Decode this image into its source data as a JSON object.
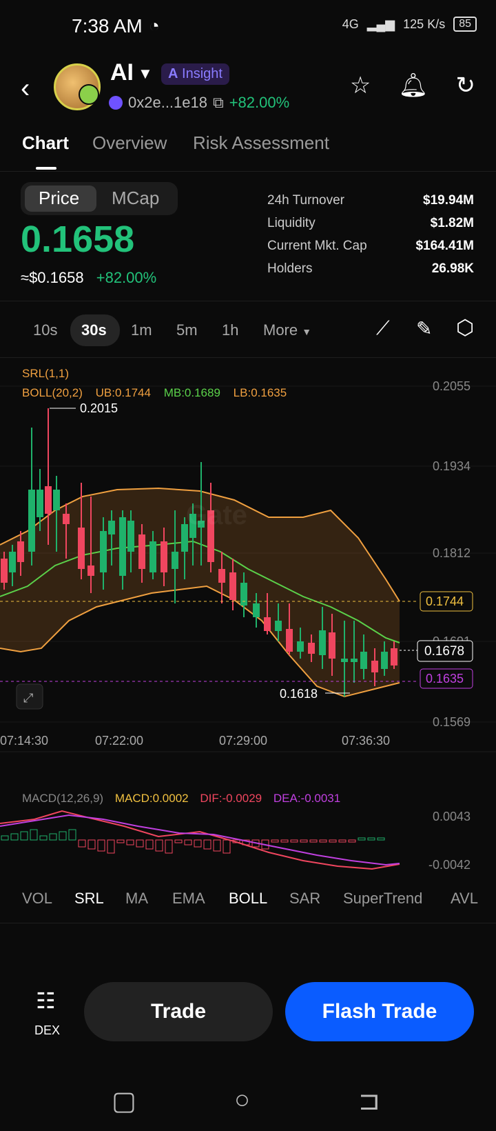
{
  "status": {
    "time": "7:38 AM",
    "net": "4G",
    "speed": "125 K/s",
    "battery": "85"
  },
  "header": {
    "token": "AI",
    "insight": "Insight",
    "address": "0x2e...1e18",
    "change": "+82.00%"
  },
  "tabs": [
    "Chart",
    "Overview",
    "Risk Assessment"
  ],
  "price": {
    "toggle": [
      "Price",
      "MCap"
    ],
    "current": "0.1658",
    "usd": "≈$0.1658",
    "change": "+82.00%"
  },
  "stats": [
    {
      "label": "24h   Turnover",
      "value": "$19.94M"
    },
    {
      "label": "Liquidity",
      "value": "$1.82M"
    },
    {
      "label": "Current Mkt. Cap",
      "value": "$164.41M"
    },
    {
      "label": "Holders",
      "value": "26.98K"
    }
  ],
  "intervals": [
    "10s",
    "30s",
    "1m",
    "5m",
    "1h",
    "More"
  ],
  "indicators": {
    "srl": "SRL(1,1)",
    "boll": "BOLL(20,2)",
    "ub": "UB:0.1744",
    "mb": "MB:0.1689",
    "lb": "LB:0.1635",
    "macd_name": "MACD(12,26,9)",
    "macd": "MACD:0.0002",
    "dif": "DIF:-0.0029",
    "dea": "DEA:-0.0031"
  },
  "chart_data": {
    "type": "candlestick",
    "y_ticks": [
      "0.2055",
      "0.1934",
      "0.1812",
      "0.1691",
      "0.1569"
    ],
    "x_ticks": [
      "07:14:30",
      "07:22:00",
      "07:29:00",
      "07:36:30"
    ],
    "annotations": {
      "high": "0.2015",
      "low": "0.1618",
      "ub_tag": "0.1744",
      "last_tag": "0.1678",
      "lb_tag": "0.1635"
    },
    "macd_ticks": [
      "0.0043",
      "-0.0042"
    ],
    "colors": {
      "up": "#1fb26b",
      "down": "#f0465f",
      "boll": "#f0a040",
      "mb": "#5bd14a",
      "dif": "#f0465f",
      "dea": "#c040e0"
    }
  },
  "indicator_bar": [
    "VOL",
    "SRL",
    "MA",
    "EMA",
    "BOLL",
    "SAR",
    "SuperTrend",
    "AVL"
  ],
  "bottom": {
    "dex": "DEX",
    "trade": "Trade",
    "flash": "Flash Trade"
  }
}
